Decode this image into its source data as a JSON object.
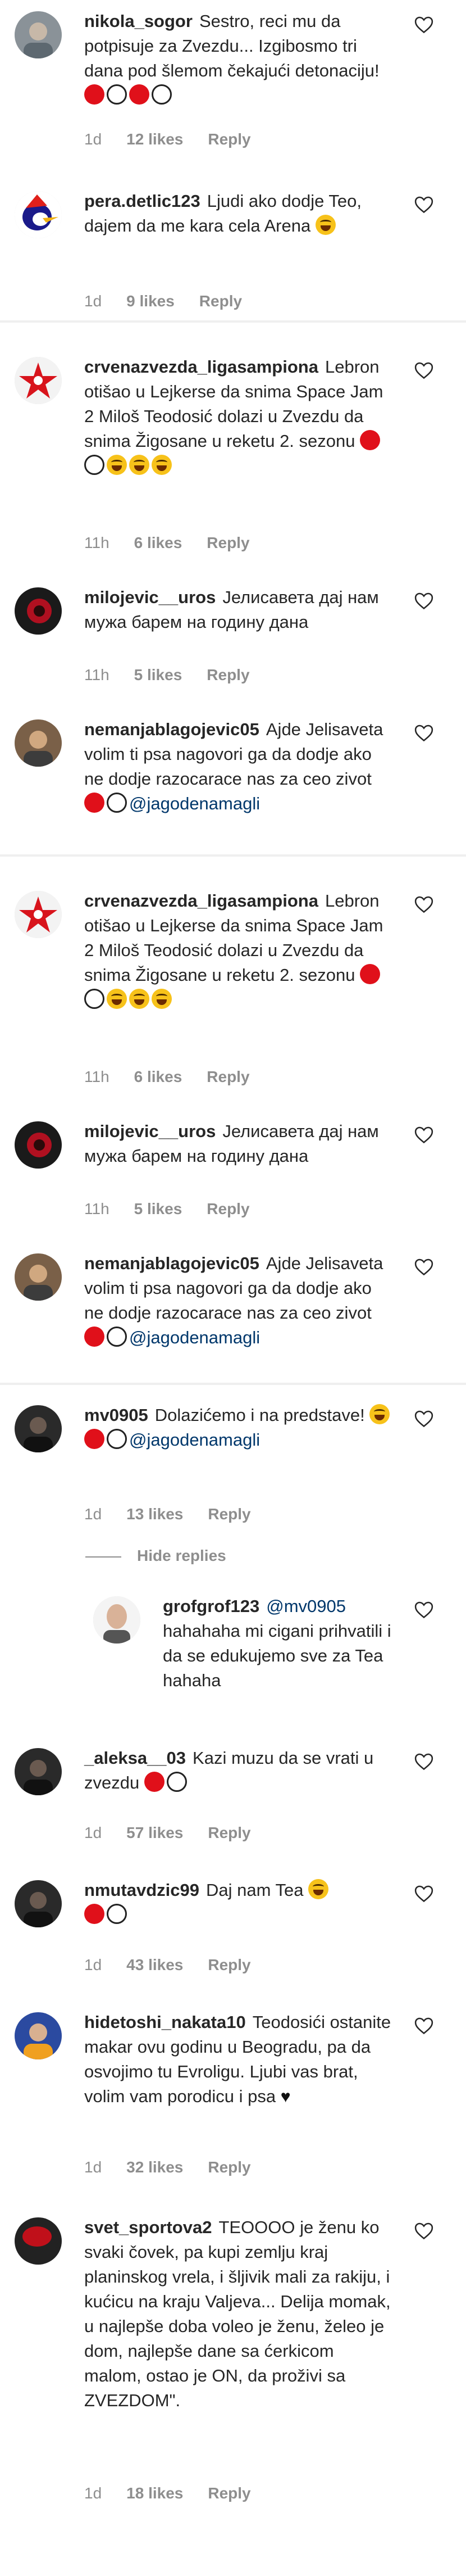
{
  "comments": [
    {
      "username": "nikola_sogor",
      "text": "Sestro, reci mu da potpisuje za Zvezdu... Izgibosmo tri dana pod šlemom čekajući detonaciju!",
      "emojis": [
        "red",
        "white",
        "red",
        "white"
      ],
      "time": "1d",
      "likes": "12 likes",
      "reply": "Reply",
      "avatar": "grey-portrait"
    },
    {
      "username": "pera.detlic123",
      "text": "Ljudi ako dodje Teo, dajem da me kara cela Arena",
      "emojis": [
        "face"
      ],
      "time": "1d",
      "likes": "9 likes",
      "reply": "Reply",
      "avatar": "woody-woodpecker"
    },
    {
      "username": "crvenazvezda_ligasampiona",
      "text": "Lebron otišao u Lejkerse da snima Space Jam 2 Miloš Teodosić dolazi u Zvezdu da snima Žigosane u reketu 2. sezonu",
      "emojis": [
        "red",
        "white",
        "face",
        "face",
        "face"
      ],
      "time": "11h",
      "likes": "6 likes",
      "reply": "Reply",
      "avatar": "red-star"
    },
    {
      "username": "milojevic__uros",
      "text": "Јелисавета дај нам мужа барем на годину дана",
      "emojis": [],
      "time": "11h",
      "likes": "5 likes",
      "reply": "Reply",
      "avatar": "dark-red"
    },
    {
      "username": "nemanjablagojevic05",
      "text": "Ajde Jelisaveta volim ti psa nagovori ga da dodje ako ne dodje razocaracе nas za ceo zivot",
      "emojis": [
        "red",
        "white"
      ],
      "mention": "@jagodenamagli",
      "time": "",
      "likes": "",
      "reply": "",
      "avatar": "portrait"
    },
    {
      "username": "crvenazvezda_ligasampiona",
      "text": "Lebron otišao u Lejkerse da snima Space Jam 2 Miloš Teodosić dolazi u Zvezdu da snima Žigosane u reketu 2. sezonu",
      "emojis": [
        "red",
        "white",
        "face",
        "face",
        "face"
      ],
      "time": "11h",
      "likes": "6 likes",
      "reply": "Reply",
      "avatar": "red-star"
    },
    {
      "username": "milojevic__uros",
      "text": "Јелисавета дај нам мужа барем на годину дана",
      "emojis": [],
      "time": "11h",
      "likes": "5 likes",
      "reply": "Reply",
      "avatar": "dark-red"
    },
    {
      "username": "nemanjablagojevic05",
      "text": "Ajde Jelisaveta volim ti psa nagovori ga da dodje ako ne dodje razocaracе nas za ceo zivot",
      "emojis": [
        "red",
        "white"
      ],
      "mention": "@jagodenamagli",
      "time": "",
      "likes": "",
      "reply": "",
      "avatar": "portrait"
    },
    {
      "username": "mv0905",
      "text": "Dolazićemo i na predstave!",
      "emojis": [
        "face"
      ],
      "emojis2": [
        "red",
        "white"
      ],
      "mention": "@jagodenamagli",
      "time": "1d",
      "likes": "13 likes",
      "reply": "Reply",
      "avatar": "dark-portrait"
    },
    {
      "username": "grofgrof123",
      "mention_prefix": "@mv0905",
      "text": "hahahaha mi cigani prihvatili i da se edukujemo sve za Tea hahaha",
      "emojis": [],
      "time": "",
      "likes": "",
      "reply": "",
      "avatar": "bald-portrait"
    },
    {
      "username": "_aleksa__03",
      "text": "Kazi muzu da se vrati u zvezdu",
      "emojis": [
        "red",
        "white"
      ],
      "time": "1d",
      "likes": "57 likes",
      "reply": "Reply",
      "avatar": "dark-portrait"
    },
    {
      "username": "nmutavdzic99",
      "text": "Daj nam Tea",
      "emojis": [
        "face"
      ],
      "emojis2": [
        "red",
        "white"
      ],
      "time": "1d",
      "likes": "43 likes",
      "reply": "Reply",
      "avatar": "dark-portrait"
    },
    {
      "username": "hidetoshi_nakata10",
      "text": "Teodosići ostanite makar ovu godinu u Beogradu, pa da osvojimo tu Evroligu. Ljubi vas brat, volim vam porodicu i psa",
      "emojis": [
        "heart"
      ],
      "time": "1d",
      "likes": "32 likes",
      "reply": "Reply",
      "avatar": "blue-portrait"
    },
    {
      "username": "svet_sportova2",
      "text": "TEOOOO je ženu ko svaki čovek, pa kupi zemlju kraj planinskog vrela, i šljivik mali za rakiju, i kućicu na kraju Valjeva... Delija momak, u najlepše doba voleo je ženu, želeo je dom, najlepše dane sa ćerkicom malom, ostao je ON, da proživi sa ZVEZDOM\".",
      "emojis": [],
      "time": "1d",
      "likes": "18 likes",
      "reply": "Reply",
      "avatar": "red-dark"
    }
  ],
  "hide_replies": "Hide replies"
}
